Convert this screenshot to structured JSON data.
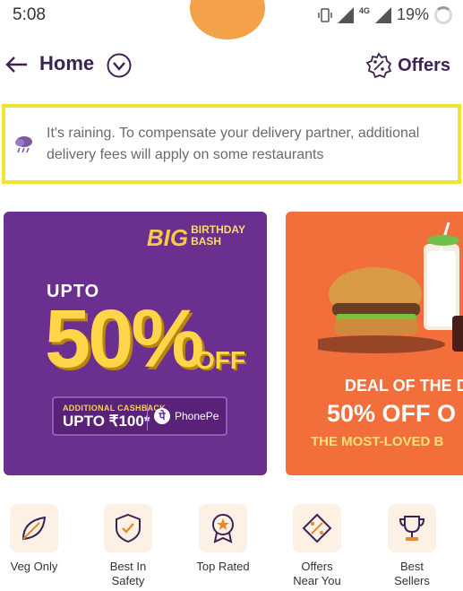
{
  "status_bar": {
    "time": "5:08",
    "network": "4G",
    "battery": "19%"
  },
  "header": {
    "title": "Home",
    "offers_label": "Offers"
  },
  "rain_banner": {
    "text": "It's raining. To compensate your delivery partner, additional delivery fees will apply on some restaurants"
  },
  "promos": [
    {
      "badge_big": "BIG",
      "badge_line1": "BIRTHDAY",
      "badge_line2": "BASH",
      "upto": "UPTO",
      "percent": "50%",
      "off": "OFF",
      "cashback_small": "ADDITIONAL CASHBACK",
      "cashback_big": "UPTO ₹100*",
      "partner": "PhonePe",
      "bg": "#6b2f8f"
    },
    {
      "line1": "DEAL OF THE D",
      "line2": "50% OFF O",
      "line3": "THE MOST-LOVED B",
      "bg": "#f26e3b"
    }
  ],
  "categories": [
    {
      "label": "Veg Only",
      "icon": "veg-leaf-icon"
    },
    {
      "label": "Best In\nSafety",
      "icon": "safety-shield-icon"
    },
    {
      "label": "Top Rated",
      "icon": "top-rated-badge-icon"
    },
    {
      "label": "Offers\nNear You",
      "icon": "offers-percent-icon"
    },
    {
      "label": "Best\nSellers",
      "icon": "trophy-icon"
    }
  ],
  "colors": {
    "brand": "#3b2354",
    "banner_border": "#f2e233",
    "accent": "#e88a2a"
  }
}
